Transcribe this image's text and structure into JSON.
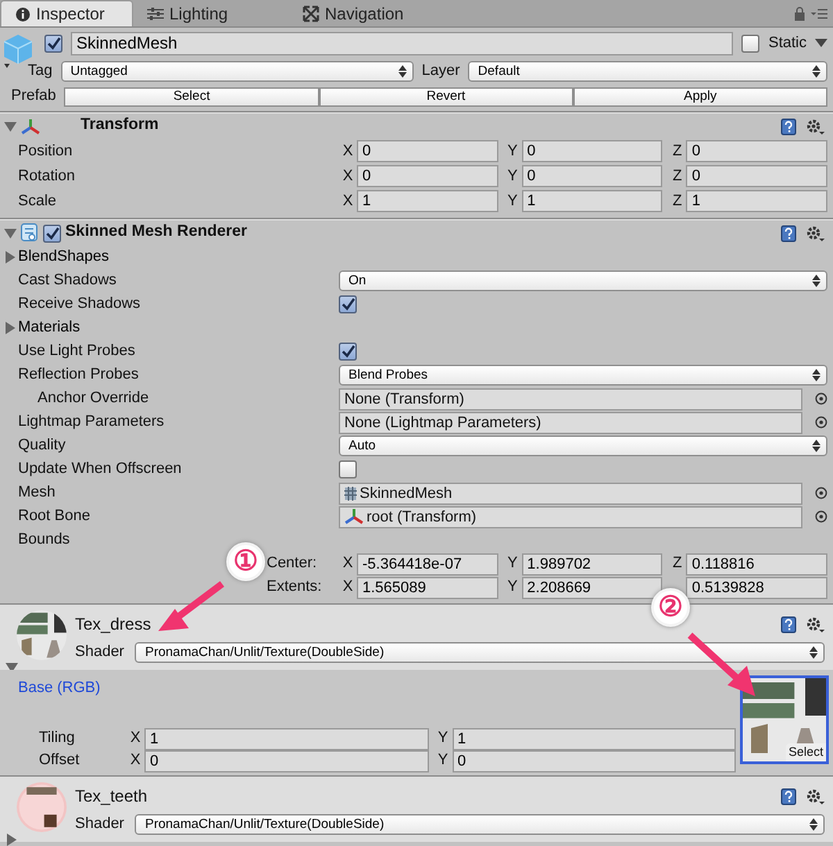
{
  "tabs": [
    {
      "label": "Inspector",
      "selected": true
    },
    {
      "label": "Lighting",
      "selected": false
    },
    {
      "label": "Navigation",
      "selected": false
    }
  ],
  "object": {
    "active": true,
    "name": "SkinnedMesh",
    "static_label": "Static",
    "static": false,
    "tag_label": "Tag",
    "tag": "Untagged",
    "layer_label": "Layer",
    "layer": "Default",
    "prefab_label": "Prefab",
    "prefab_buttons": [
      "Select",
      "Revert",
      "Apply"
    ]
  },
  "transform": {
    "title": "Transform",
    "expanded": true,
    "rows": [
      {
        "label": "Position",
        "values": [
          {
            "axis": "X",
            "value": "0"
          },
          {
            "axis": "Y",
            "value": "0"
          },
          {
            "axis": "Z",
            "value": "0"
          }
        ]
      },
      {
        "label": "Rotation",
        "values": [
          {
            "axis": "X",
            "value": "0"
          },
          {
            "axis": "Y",
            "value": "0"
          },
          {
            "axis": "Z",
            "value": "0"
          }
        ]
      },
      {
        "label": "Scale",
        "values": [
          {
            "axis": "X",
            "value": "1"
          },
          {
            "axis": "Y",
            "value": "1"
          },
          {
            "axis": "Z",
            "value": "1"
          }
        ]
      }
    ]
  },
  "renderer": {
    "title": "Skinned Mesh Renderer",
    "enabled": true,
    "expanded": true,
    "properties": [
      {
        "kind": "foldout",
        "label": "BlendShapes",
        "expanded": false
      },
      {
        "kind": "dropdown",
        "label": "Cast Shadows",
        "value": "On"
      },
      {
        "kind": "checkbox",
        "label": "Receive Shadows",
        "checked": true
      },
      {
        "kind": "foldout",
        "label": "Materials",
        "expanded": false
      },
      {
        "kind": "checkbox",
        "label": "Use Light Probes",
        "checked": true
      },
      {
        "kind": "dropdown",
        "label": "Reflection Probes",
        "value": "Blend Probes",
        "children": [
          {
            "kind": "object",
            "label": "Anchor Override",
            "value": "None (Transform)"
          }
        ]
      },
      {
        "kind": "object",
        "label": "Lightmap Parameters",
        "value": "None (Lightmap Parameters)"
      },
      {
        "kind": "dropdown",
        "label": "Quality",
        "value": "Auto"
      },
      {
        "kind": "checkbox",
        "label": "Update When Offscreen",
        "checked": false
      },
      {
        "kind": "object",
        "label": "Mesh",
        "value": "SkinnedMesh"
      },
      {
        "kind": "object",
        "label": "Root Bone",
        "value": "root (Transform)"
      },
      {
        "kind": "bounds",
        "label": "Bounds",
        "children": [
          {
            "label": "Center:",
            "values": [
              {
                "axis": "X",
                "value": "-5.364418e-07"
              },
              {
                "axis": "Y",
                "value": "1.989702"
              },
              {
                "axis": "Z",
                "value": "0.118816"
              }
            ]
          },
          {
            "label": "Extents:",
            "values": [
              {
                "axis": "X",
                "value": "1.565089"
              },
              {
                "axis": "Y",
                "value": "2.208669"
              },
              {
                "value": "0.5139828"
              }
            ]
          }
        ]
      }
    ]
  },
  "materials": [
    {
      "name": "Tex_dress",
      "shader_label": "Shader",
      "shader": "PronamaChan/Unlit/Texture(DoubleSide)",
      "expanded": true,
      "texture": {
        "label": "Base (RGB)",
        "select_label": "Select",
        "rows": [
          {
            "label": "Tiling",
            "values": [
              {
                "axis": "X",
                "value": "1"
              },
              {
                "axis": "Y",
                "value": "1"
              }
            ]
          },
          {
            "label": "Offset",
            "values": [
              {
                "axis": "X",
                "value": "0"
              },
              {
                "axis": "Y",
                "value": "0"
              }
            ]
          }
        ]
      }
    },
    {
      "name": "Tex_teeth",
      "shader_label": "Shader",
      "shader": "PronamaChan/Unlit/Texture(DoubleSide)",
      "expanded": false
    }
  ],
  "annotations": [
    {
      "text": "①"
    },
    {
      "text": "②"
    }
  ]
}
